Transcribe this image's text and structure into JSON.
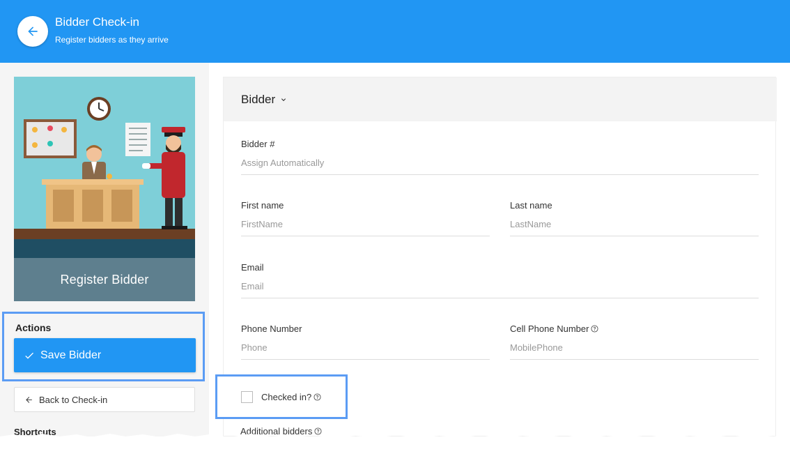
{
  "header": {
    "title": "Bidder Check-in",
    "subtitle": "Register bidders as they arrive",
    "back_icon": "arrow-left-icon",
    "color": "#2196f3"
  },
  "sidebar": {
    "hero_label": "Register Bidder",
    "actions": {
      "title": "Actions",
      "save_label": "Save Bidder",
      "save_icon": "check-icon"
    },
    "back_to_checkin_label": "Back to Check-in",
    "shortcuts_title": "Shortcuts"
  },
  "form": {
    "section_title": "Bidder",
    "bidder_number": {
      "label": "Bidder #",
      "placeholder": "Assign Automatically"
    },
    "first_name": {
      "label": "First name",
      "placeholder": "FirstName"
    },
    "last_name": {
      "label": "Last name",
      "placeholder": "LastName"
    },
    "email": {
      "label": "Email",
      "placeholder": "Email"
    },
    "phone": {
      "label": "Phone Number",
      "placeholder": "Phone"
    },
    "cell_phone": {
      "label": "Cell Phone Number",
      "placeholder": "MobilePhone"
    },
    "checked_in": {
      "label": "Checked in?",
      "checked": false
    },
    "additional_bidders": {
      "label": "Additional bidders"
    }
  },
  "colors": {
    "accent": "#2196f3",
    "highlight": "#5b9cf4",
    "hero_band": "#5e7f8e"
  }
}
